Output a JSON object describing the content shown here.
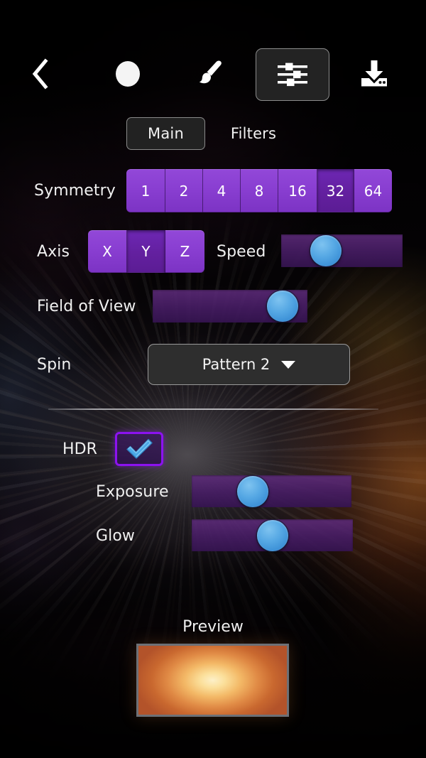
{
  "toolbar": {
    "back_icon": "chevron-left-icon",
    "shape_icon": "filled-circle-icon",
    "brush_icon": "paintbrush-icon",
    "settings_icon": "sliders-icon",
    "export_icon": "download-tray-icon",
    "selected": "settings"
  },
  "tabs": {
    "items": [
      {
        "id": "main",
        "label": "Main",
        "selected": true
      },
      {
        "id": "filters",
        "label": "Filters",
        "selected": false
      }
    ]
  },
  "controls": {
    "symmetry": {
      "label": "Symmetry",
      "options": [
        "1",
        "2",
        "4",
        "8",
        "16",
        "32",
        "64"
      ],
      "selected": "32"
    },
    "axis": {
      "label": "Axis",
      "options": [
        "X",
        "Y",
        "Z"
      ],
      "selected": "Y"
    },
    "speed": {
      "label": "Speed",
      "value_percent": 37
    },
    "field_of_view": {
      "label": "Field of View",
      "value_percent": 84
    },
    "spin": {
      "label": "Spin",
      "selected_option": "Pattern 2",
      "caret_icon": "chevron-down-icon"
    },
    "hdr": {
      "label": "HDR",
      "checked": true,
      "check_icon": "checkmark-icon"
    },
    "exposure": {
      "label": "Exposure",
      "value_percent": 38
    },
    "glow": {
      "label": "Glow",
      "value_percent": 50
    }
  },
  "preview": {
    "label": "Preview"
  },
  "colors": {
    "accent_purple": "#8a3fd2",
    "accent_purple_selected": "#63209f",
    "slider_thumb_blue": "#56a8e4",
    "slider_track_purple": "#46205f",
    "hdr_border_purple": "#8c12f0",
    "panel_dark": "#2e2e2e",
    "text_primary": "#f0f0f0",
    "preview_core": "#fdf0c8",
    "preview_edge": "#b3532a"
  }
}
